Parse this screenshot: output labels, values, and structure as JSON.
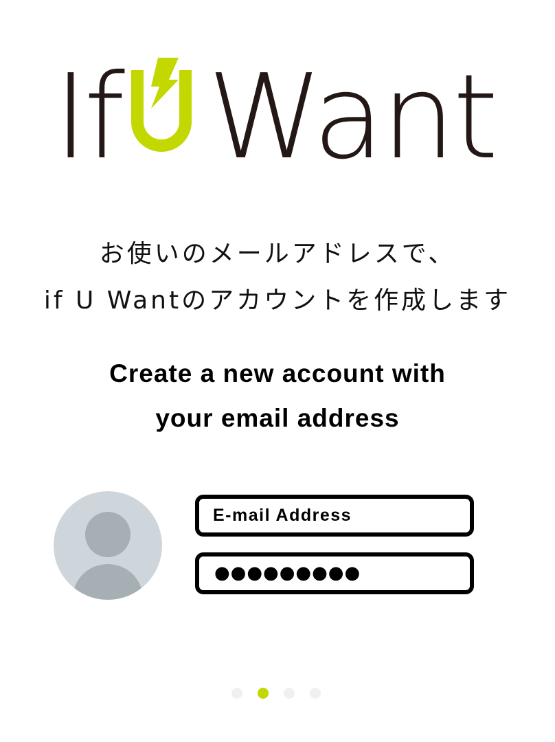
{
  "logo": {
    "text_left": "If",
    "letter_u": "U",
    "text_right": "Want",
    "icon": "lightning-bolt-icon",
    "accent_color": "#c3d700",
    "text_color": "#231815"
  },
  "intro_ja": {
    "line1": "お使いのメールアドレスで、",
    "line2": "if U Wantのアカウントを作成します"
  },
  "intro_en": {
    "line1": "Create a new account with",
    "line2": "your email address"
  },
  "avatar": {
    "icon": "user-avatar-icon"
  },
  "form": {
    "email_placeholder": "E-mail Address",
    "password_value": "●●●●●●●●●"
  },
  "pager": {
    "total": 4,
    "active_index": 1
  }
}
